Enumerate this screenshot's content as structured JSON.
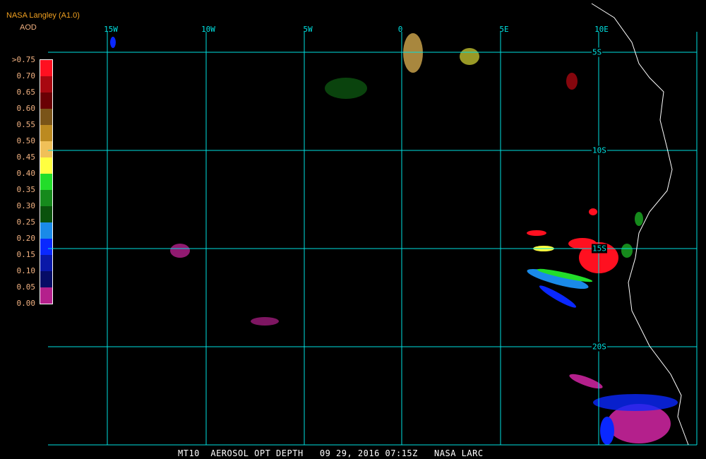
{
  "header": {
    "title": "NASA Langley (A1.0)",
    "variable": "AOD"
  },
  "legend": {
    "labels": [
      ">0.75",
      "0.70",
      "0.65",
      "0.60",
      "0.55",
      "0.50",
      "0.45",
      "0.40",
      "0.35",
      "0.30",
      "0.25",
      "0.20",
      "0.15",
      "0.10",
      "0.05",
      "0.00"
    ],
    "colors": [
      "#ff1020",
      "#a80810",
      "#6a0004",
      "#7a5418",
      "#bc8a20",
      "#f0c058",
      "#ffff40",
      "#22dd2a",
      "#168a1c",
      "#0a520c",
      "#1a8ae8",
      "#0a28ff",
      "#0a18a8",
      "#060c66",
      "#b4208c"
    ]
  },
  "map": {
    "longitude_labels": [
      "15W",
      "10W",
      "5W",
      "0",
      "5E",
      "10E"
    ],
    "latitude_labels": [
      "5S",
      "10S",
      "15S",
      "20S"
    ],
    "grid_color": "#00e0e0",
    "coast_color": "#ffffff"
  },
  "footer": {
    "text": "MT10  AEROSOL OPT DEPTH   09 29, 2016 07:15Z   NASA LARC"
  }
}
